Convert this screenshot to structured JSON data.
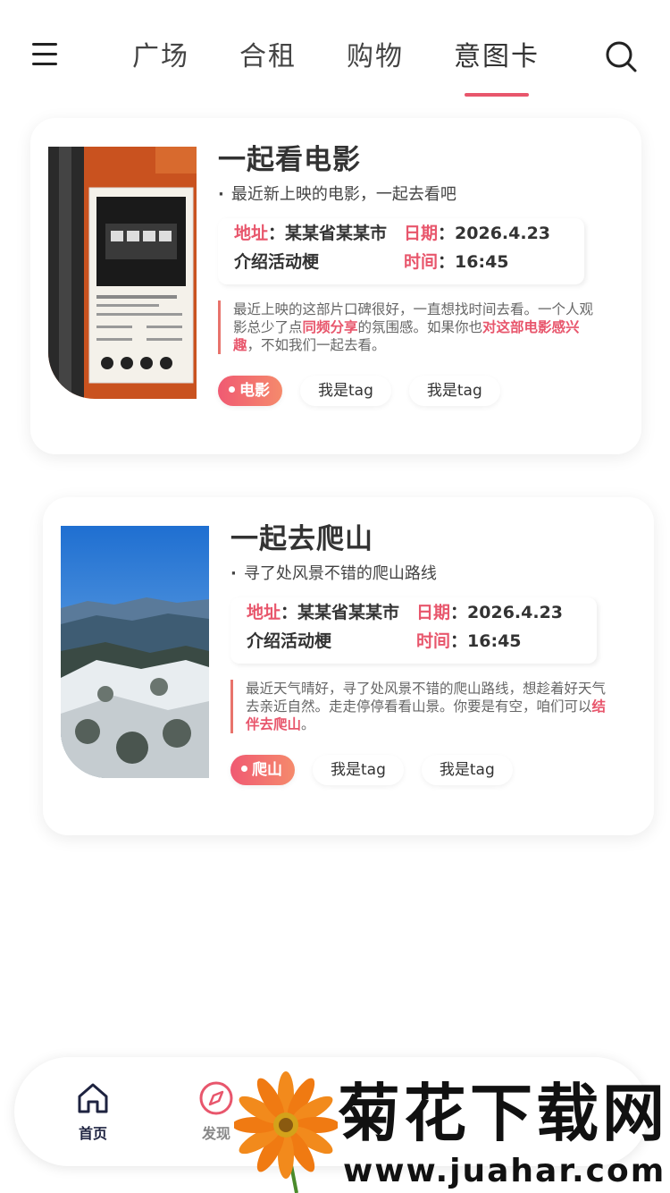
{
  "header": {
    "tabs": [
      {
        "label": "广场"
      },
      {
        "label": "合租"
      },
      {
        "label": "购物"
      },
      {
        "label": "意图卡"
      }
    ],
    "active_tab": "意图卡"
  },
  "cards": [
    {
      "title": "一起看电影",
      "subtitle": "最近新上映的电影，一起去看吧",
      "address_label": "地址",
      "address_value": "某某省某某市",
      "date_label": "日期",
      "date_value": "2026.4.23",
      "intro": "介绍活动梗",
      "time_label": "时间",
      "time_value": "16:45",
      "desc_1": "最近上映的这部片口碑很好，一直想找时间去看。一个人观影总少了点",
      "desc_hl_1": "同频分享",
      "desc_2": "的氛围感。如果你也",
      "desc_hl_2": "对这部电影感兴趣",
      "desc_3": "，不如我们一起去看。",
      "tags": [
        "电影",
        "我是tag",
        "我是tag"
      ],
      "image": "movie-ticket-photo"
    },
    {
      "title": "一起去爬山",
      "subtitle": "寻了处风景不错的爬山路线",
      "address_label": "地址",
      "address_value": "某某省某某市",
      "date_label": "日期",
      "date_value": "2026.4.23",
      "intro": "介绍活动梗",
      "time_label": "时间",
      "time_value": "16:45",
      "desc_1": "最近天气晴好，寻了处风景不错的爬山路线，想趁着好天气去亲近自然。走走停停看看山景。你要是有空，咱们可以",
      "desc_hl_1": "结伴去爬山",
      "desc_2": "。",
      "tags": [
        "爬山",
        "我是tag",
        "我是tag"
      ],
      "image": "snowy-mountain-photo"
    }
  ],
  "bottom_nav": {
    "items": [
      {
        "label": "首页",
        "icon": "home-icon"
      },
      {
        "label": "发现",
        "icon": "compass-icon"
      }
    ]
  },
  "watermark": {
    "text": "菊花下载网",
    "url": "www.juahar.com"
  },
  "colors": {
    "accent": "#e8566c",
    "nav_active": "#1e2340"
  }
}
